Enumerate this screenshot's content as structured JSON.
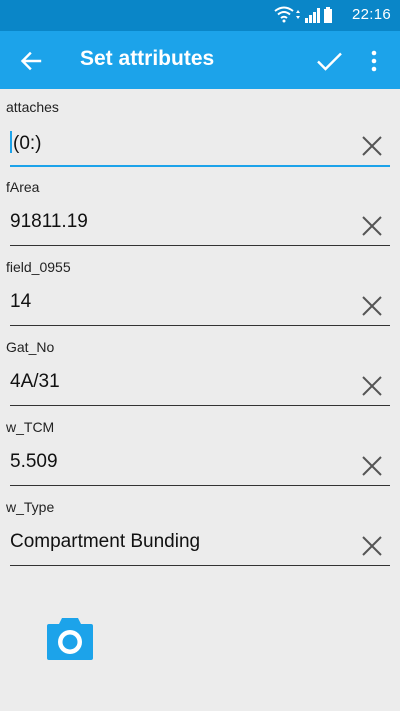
{
  "status_bar": {
    "time": "22:16",
    "icons": [
      "wifi-icon",
      "data-arrows-icon",
      "signal-icon",
      "battery-icon"
    ]
  },
  "toolbar": {
    "title": "Set attributes",
    "back_icon": "arrow-left-icon",
    "confirm_icon": "checkmark-icon",
    "more_icon": "more-vertical-icon"
  },
  "fields": [
    {
      "label": "attaches",
      "value": "(0:)"
    },
    {
      "label": "fArea",
      "value": "91811.19"
    },
    {
      "label": "field_0955",
      "value": "14"
    },
    {
      "label": "Gat_No",
      "value": "4A/31"
    },
    {
      "label": "w_TCM",
      "value": "5.509"
    },
    {
      "label": "w_Type",
      "value": "Compartment Bunding"
    }
  ],
  "camera_icon": "camera-icon",
  "colors": {
    "status_bar": "#0a86c8",
    "toolbar": "#1ca3ea",
    "background": "#ececec",
    "accent": "#1ca3ea"
  }
}
